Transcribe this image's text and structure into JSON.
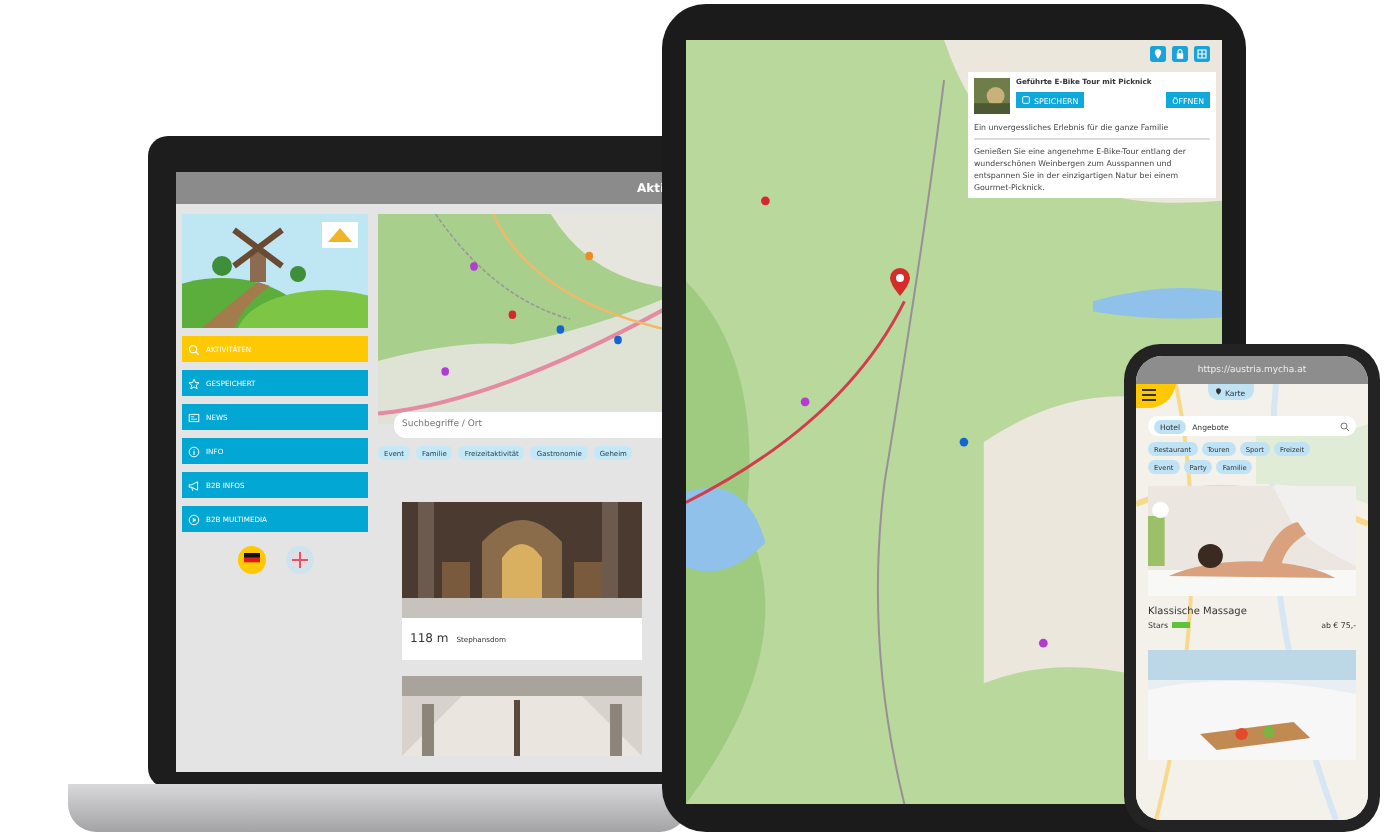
{
  "laptop": {
    "header_title": "Akti",
    "sidebar": {
      "items": [
        {
          "label": "AKTIVITÄTEN",
          "kind": "search",
          "selected": true
        },
        {
          "label": "GESPEICHERT",
          "kind": "star",
          "selected": false
        },
        {
          "label": "NEWS",
          "kind": "news",
          "selected": false
        },
        {
          "label": "INFO",
          "kind": "info",
          "selected": false
        },
        {
          "label": "B2B INFOS",
          "kind": "megaphone",
          "selected": false
        },
        {
          "label": "B2B MULTIMEDIA",
          "kind": "play",
          "selected": false
        }
      ]
    },
    "languages": [
      {
        "kind": "german",
        "selected": true
      },
      {
        "kind": "english",
        "selected": false
      }
    ],
    "search": {
      "placeholder": "Suchbegriffe / Ort"
    },
    "chips": [
      "Event",
      "Familie",
      "Freizeitaktivität",
      "Gastronomie",
      "Geheim"
    ],
    "cards": [
      {
        "kind": "picture",
        "distance": "118 m",
        "title": "Stephansdom"
      }
    ]
  },
  "tablet": {
    "popup": {
      "title": "Geführte E-Bike Tour mit Picknick",
      "save_button": "SPEICHERN",
      "open_button": "ÖFFNEN",
      "subtitle": "Ein unvergessliches Erlebnis für die ganze Familie",
      "description": "Genießen Sie eine angenehme E-Bike-Tour entlang der wunderschönen Weinbergen zum Ausspannen und entspannen Sie in der einzigartigen Natur bei einem Gourmet-Picknick."
    }
  },
  "phone": {
    "url": "https://austria.mycha.at",
    "map_tab": "Karte",
    "search": {
      "category": "Hotel",
      "placeholder": "Angebote"
    },
    "chips": [
      "Restaurant",
      "Touren",
      "Sport",
      "Freizeit",
      "Event",
      "Party",
      "Familie"
    ],
    "card": {
      "title": "Klassische Massage",
      "rating_label": "Stars",
      "price": "ab € 75,-"
    }
  }
}
